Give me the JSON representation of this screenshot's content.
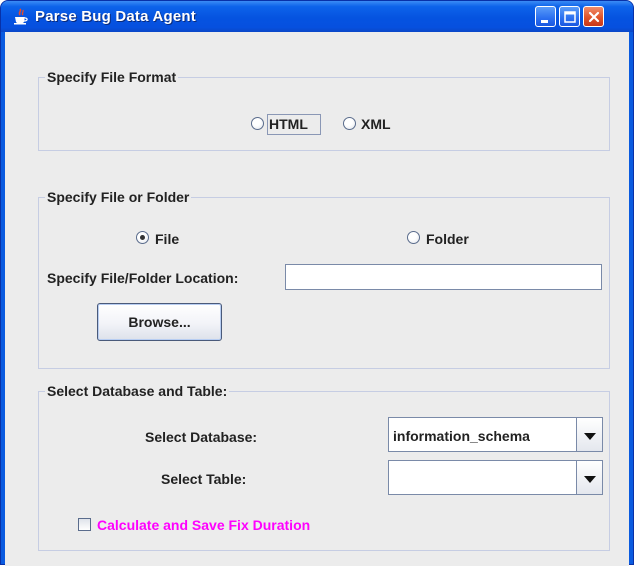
{
  "window": {
    "title": "Parse Bug Data Agent",
    "icon": "java-cup-icon",
    "controls": [
      "minimize-icon",
      "maximize-icon",
      "close-icon"
    ]
  },
  "file_format": {
    "legend": "Specify File Format",
    "options": [
      {
        "label": "HTML",
        "checked": false,
        "focused": true
      },
      {
        "label": "XML",
        "checked": false
      }
    ]
  },
  "file_or_folder": {
    "legend": "Specify File or Folder",
    "options": [
      {
        "label": "File",
        "checked": true
      },
      {
        "label": "Folder",
        "checked": false
      }
    ],
    "location_label": "Specify File/Folder Location:",
    "location_value": "",
    "browse_label": "Browse..."
  },
  "database": {
    "legend": "Select Database and Table:",
    "db_label": "Select Database:",
    "db_value": "information_schema",
    "table_label": "Select Table:",
    "table_value": "",
    "checkbox_label": "Calculate and Save Fix Duration",
    "checkbox_checked": false,
    "checkbox_color": "#ff00ff"
  },
  "colors": {
    "titlebar": "#0553e0",
    "panel": "#ececec",
    "group_border": "#c6cde3"
  }
}
